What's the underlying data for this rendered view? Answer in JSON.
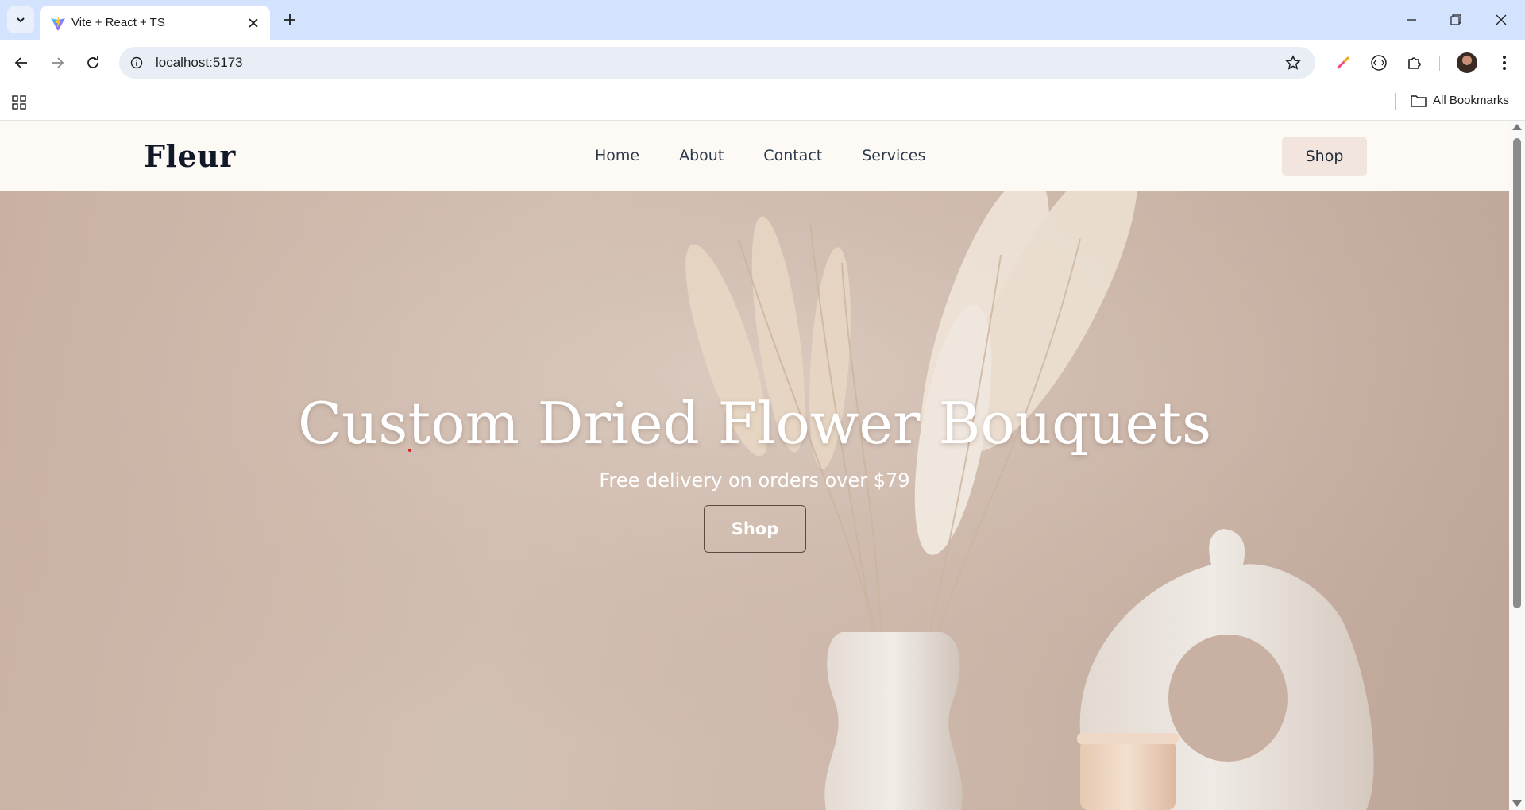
{
  "browser": {
    "tab_title": "Vite + React + TS",
    "url": "localhost:5173",
    "bookmarks_label": "All Bookmarks",
    "icons": [
      "tab-search-icon",
      "vite-favicon-icon",
      "close-icon",
      "plus-icon",
      "minimize-icon",
      "restore-icon",
      "close-window-icon",
      "back-arrow-icon",
      "forward-arrow-icon",
      "reload-icon",
      "site-info-icon",
      "bookmark-star-icon",
      "color-picker-extension-icon",
      "extension-icon",
      "puzzle-icon",
      "avatar",
      "more-icon",
      "apps-grid-icon",
      "folder-icon"
    ]
  },
  "site": {
    "logo": "Fleur",
    "nav": {
      "home": "Home",
      "about": "About",
      "contact": "Contact",
      "services": "Services"
    },
    "header_shop": "Shop",
    "hero": {
      "title": "Custom Dried Flower Bouquets",
      "subtitle": "Free delivery on orders over $79",
      "cta": "Shop"
    }
  },
  "colors": {
    "header_bg": "#fdf9f5",
    "shop_button_bg": "#f1e5dd",
    "hero_bg": "#cdb8ab",
    "tabstrip_bg": "#d3e3fd"
  }
}
